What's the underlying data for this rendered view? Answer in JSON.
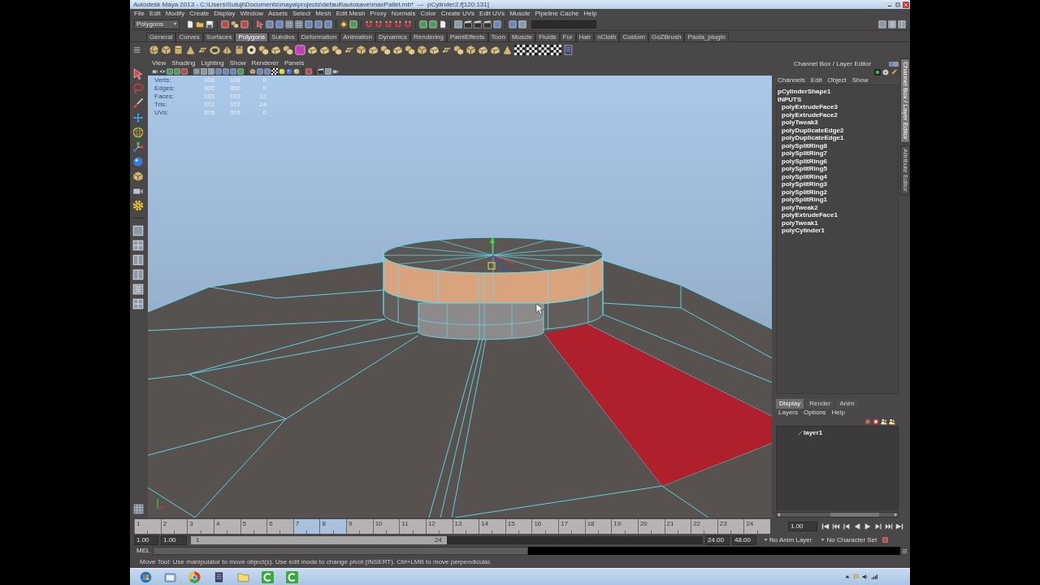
{
  "window": {
    "title": "Autodesk Maya 2013 - C:\\Users\\Sutuji\\Documents\\maya\\projects\\default\\autosave\\maxPallet.mb*  ---  pCylinder2.f[120:131]"
  },
  "menu_bar": [
    "File",
    "Edit",
    "Modify",
    "Create",
    "Display",
    "Window",
    "Assets",
    "Select",
    "Mesh",
    "Edit Mesh",
    "Proxy",
    "Normals",
    "Color",
    "Create UVs",
    "Edit UVs",
    "Muscle",
    "Pipeline Cache",
    "Help"
  ],
  "status_line": {
    "menu_set": "Polygons"
  },
  "shelf": {
    "tabs": [
      {
        "label": "General",
        "selected": false
      },
      {
        "label": "Curves",
        "selected": false
      },
      {
        "label": "Surfaces",
        "selected": false
      },
      {
        "label": "Polygons",
        "selected": true
      },
      {
        "label": "Subdivs",
        "selected": false
      },
      {
        "label": "Deformation",
        "selected": false
      },
      {
        "label": "Animation",
        "selected": false
      },
      {
        "label": "Dynamics",
        "selected": false
      },
      {
        "label": "Rendering",
        "selected": false
      },
      {
        "label": "PaintEffects",
        "selected": false
      },
      {
        "label": "Toon",
        "selected": false
      },
      {
        "label": "Muscle",
        "selected": false
      },
      {
        "label": "Fluids",
        "selected": false
      },
      {
        "label": "Fur",
        "selected": false
      },
      {
        "label": "Hair",
        "selected": false
      },
      {
        "label": "nCloth",
        "selected": false
      },
      {
        "label": "Custom",
        "selected": false
      },
      {
        "label": "GoZBrush",
        "selected": false
      },
      {
        "label": "Paola_plugin",
        "selected": false
      }
    ]
  },
  "viewport": {
    "menu": [
      "View",
      "Shading",
      "Lighting",
      "Show",
      "Renderer",
      "Panels"
    ],
    "hud": [
      {
        "label": "Verts:",
        "values": [
          "108",
          "108",
          "0"
        ]
      },
      {
        "label": "Edges:",
        "values": [
          "300",
          "300",
          "0"
        ]
      },
      {
        "label": "Faces:",
        "values": [
          "193",
          "193",
          "12"
        ]
      },
      {
        "label": "Tris:",
        "values": [
          "372",
          "372",
          "24"
        ]
      },
      {
        "label": "UVs:",
        "values": [
          "376",
          "376",
          "0"
        ]
      }
    ]
  },
  "channel_box": {
    "title": "Channel Box / Layer Editor",
    "menu": [
      "Channels",
      "Edit",
      "Object",
      "Show"
    ],
    "shape": "pCylinderShape1",
    "section": "INPUTS",
    "inputs": [
      "polyExtrudeFace3",
      "polyExtrudeFace2",
      "polyTweak3",
      "polyDuplicateEdge2",
      "polyDuplicateEdge1",
      "polySplitRing8",
      "polySplitRing7",
      "polySplitRing6",
      "polySplitRing5",
      "polySplitRing4",
      "polySplitRing3",
      "polySplitRing2",
      "polySplitRing1",
      "polyTweak2",
      "polyExtrudeFace1",
      "polyTweak1",
      "polyCylinder1"
    ]
  },
  "side_tabs": [
    {
      "label": "Channel Box / Layer Editor",
      "selected": true
    },
    {
      "label": "Attribute Editor",
      "selected": false
    }
  ],
  "layer_editor": {
    "tabs": [
      {
        "label": "Display",
        "selected": true
      },
      {
        "label": "Render",
        "selected": false
      },
      {
        "label": "Anim",
        "selected": false
      }
    ],
    "menu": [
      "Layers",
      "Options",
      "Help"
    ],
    "layers": [
      {
        "name": "layer1"
      }
    ]
  },
  "time_slider": {
    "frames": [
      {
        "label": "1",
        "marked": false
      },
      {
        "label": "2",
        "marked": false
      },
      {
        "label": "3",
        "marked": false
      },
      {
        "label": "4",
        "marked": false
      },
      {
        "label": "5",
        "marked": false
      },
      {
        "label": "6",
        "marked": false
      },
      {
        "label": "7",
        "marked": true
      },
      {
        "label": "8",
        "marked": true
      },
      {
        "label": "9",
        "marked": false
      },
      {
        "label": "10",
        "marked": false
      },
      {
        "label": "11",
        "marked": false
      },
      {
        "label": "12",
        "marked": false
      },
      {
        "label": "13",
        "marked": false
      },
      {
        "label": "14",
        "marked": false
      },
      {
        "label": "15",
        "marked": false
      },
      {
        "label": "16",
        "marked": false
      },
      {
        "label": "17",
        "marked": false
      },
      {
        "label": "18",
        "marked": false
      },
      {
        "label": "19",
        "marked": false
      },
      {
        "label": "20",
        "marked": false
      },
      {
        "label": "21",
        "marked": false
      },
      {
        "label": "22",
        "marked": false
      },
      {
        "label": "23",
        "marked": false
      },
      {
        "label": "24",
        "marked": false
      }
    ],
    "current_frame": "1.00"
  },
  "range_slider": {
    "start_time": "1.00",
    "playback_start": "1.00",
    "range_start": "1",
    "range_end": "24",
    "level": 0.5,
    "playback_end": "24.00",
    "end_time": "48.00",
    "anim_layer": "No Anim Layer",
    "character_set": "No Character Set"
  },
  "command_line": {
    "language": "MEL"
  },
  "help_line": "Move Tool: Use manipulator to move object(s). Use edit mode to change pivot (INSERT). Ctrl+LMB to move perpendicular."
}
